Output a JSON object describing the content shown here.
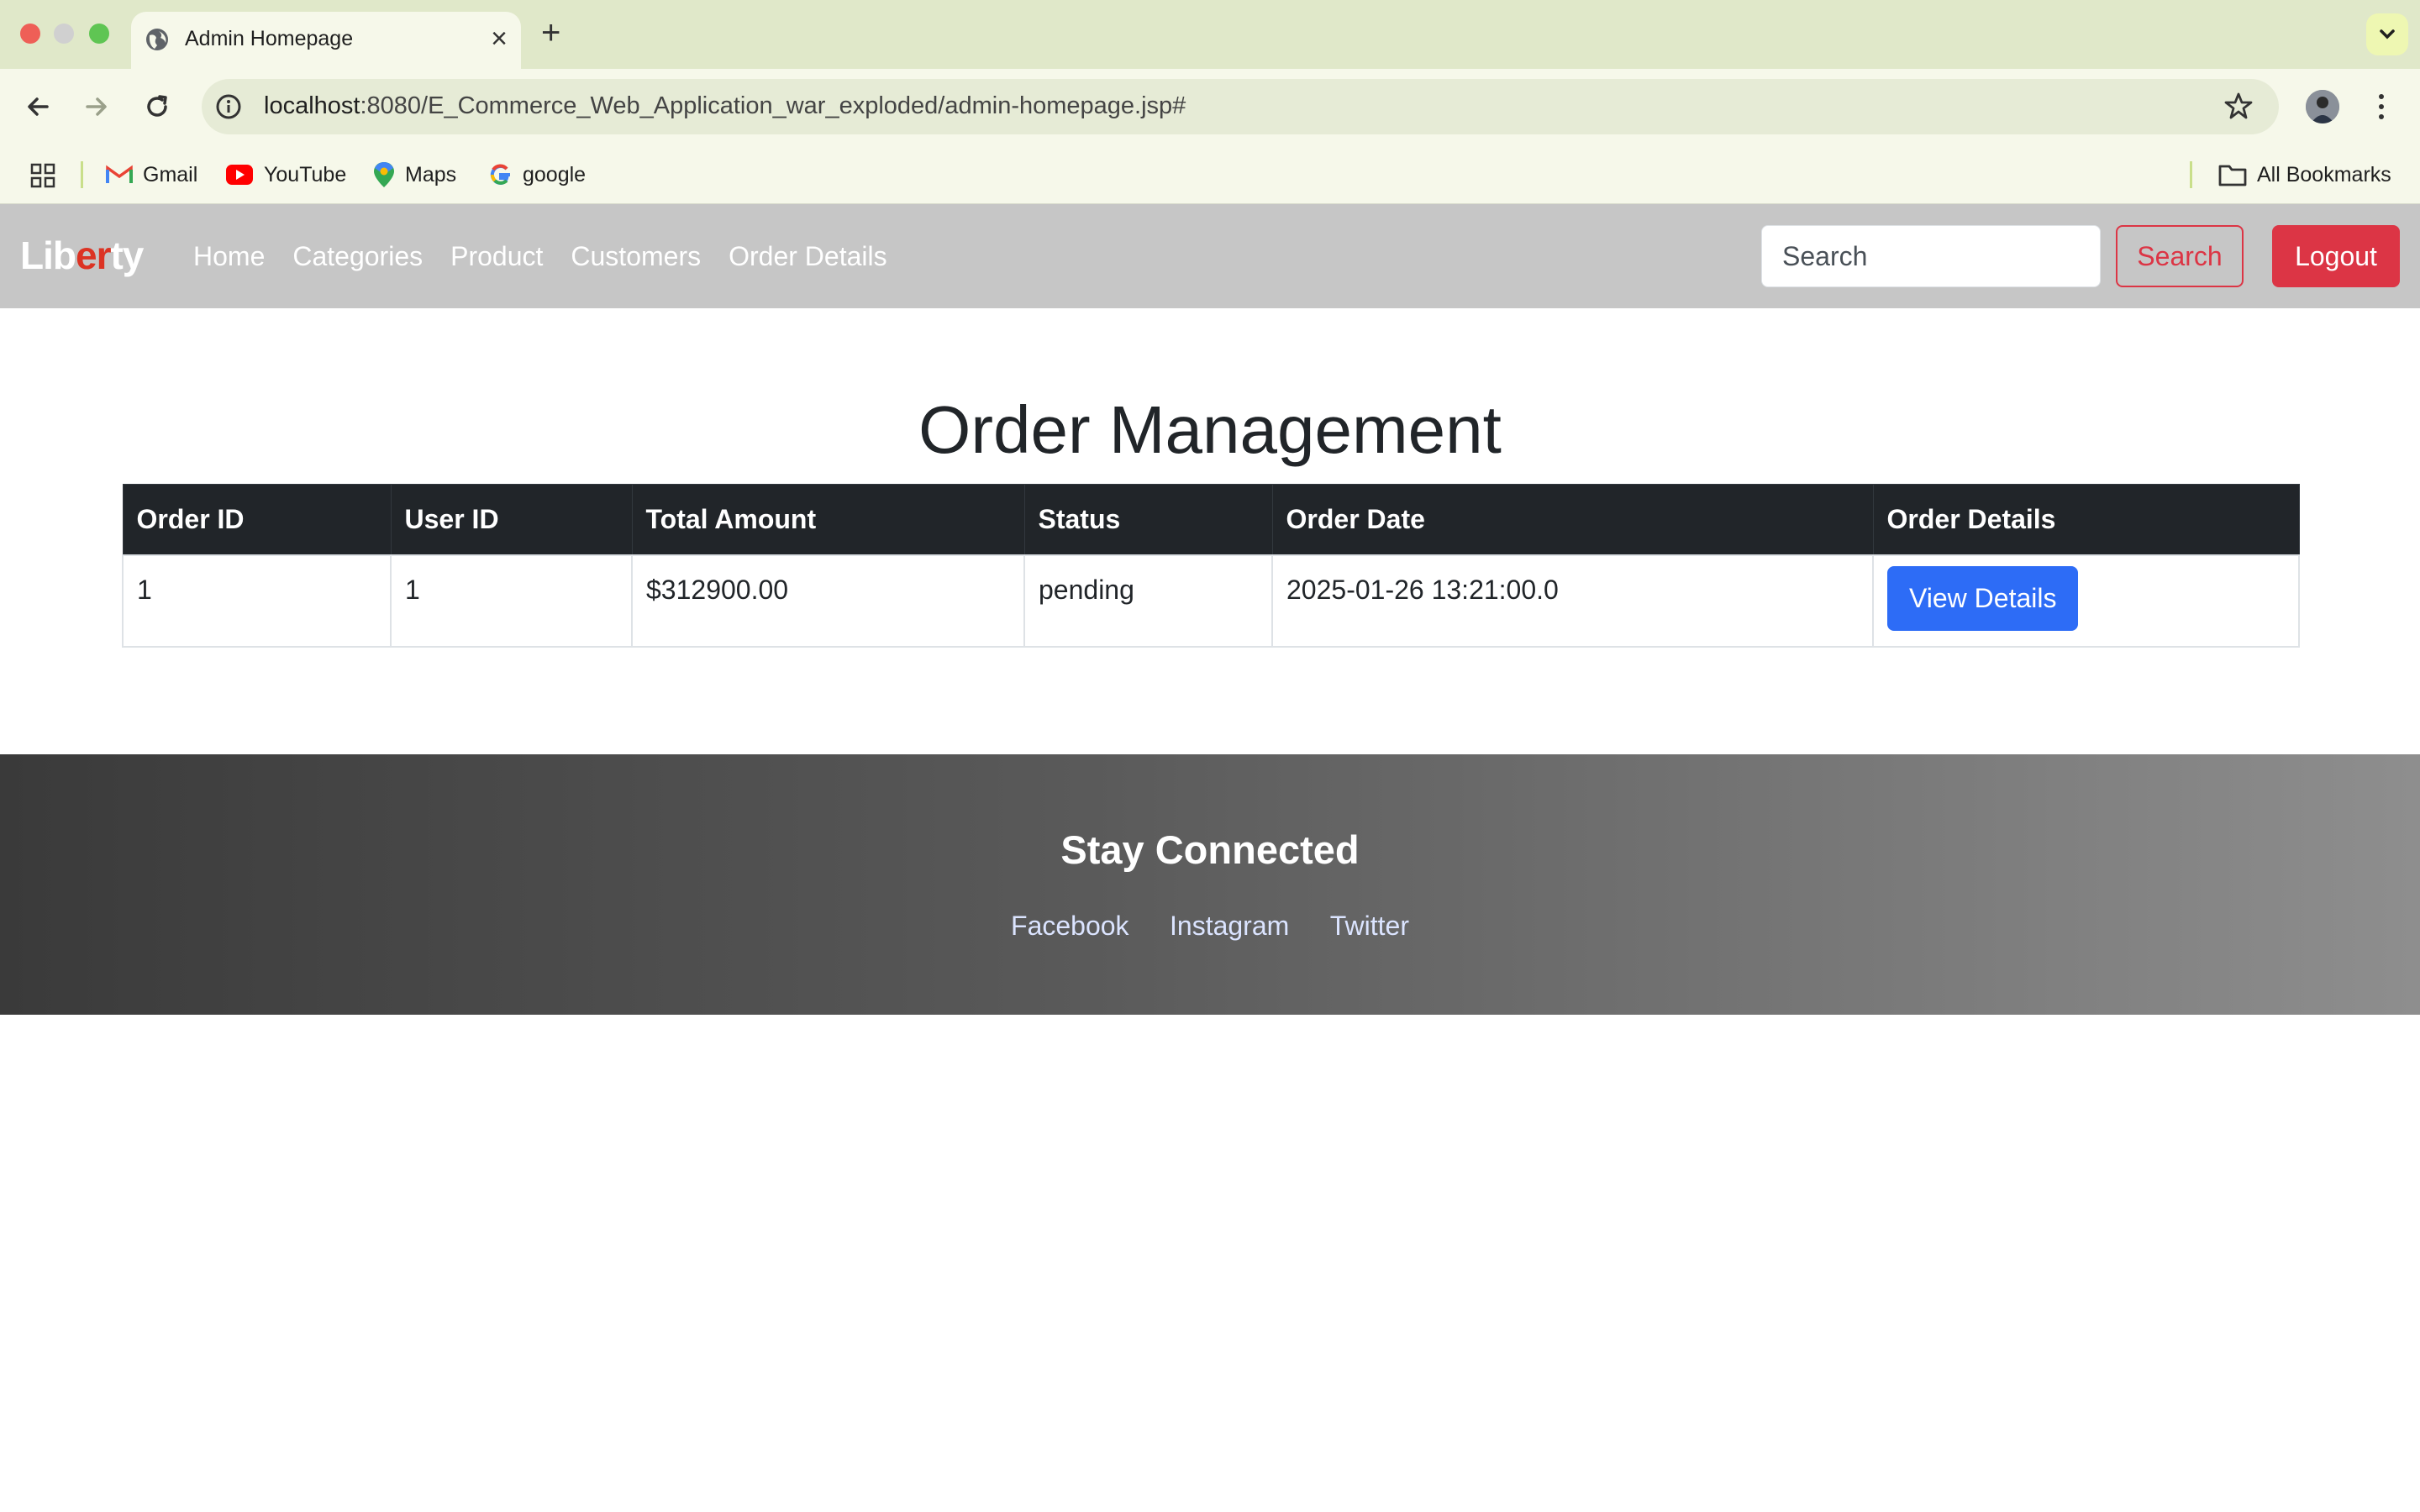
{
  "browser": {
    "tab_title": "Admin Homepage",
    "url_host": "localhost",
    "url_rest": ":8080/E_Commerce_Web_Application_war_exploded/admin-homepage.jsp#",
    "bookmarks": [
      {
        "label": "Gmail",
        "icon": "gmail-icon"
      },
      {
        "label": "YouTube",
        "icon": "youtube-icon"
      },
      {
        "label": "Maps",
        "icon": "maps-icon"
      },
      {
        "label": "google",
        "icon": "google-icon"
      }
    ],
    "all_bookmarks_label": "All Bookmarks"
  },
  "navbar": {
    "brand_parts": [
      "Lib",
      "er",
      "ty"
    ],
    "links": [
      "Home",
      "Categories",
      "Product",
      "Customers",
      "Order Details"
    ],
    "search_placeholder": "Search",
    "search_button": "Search",
    "logout_button": "Logout"
  },
  "main": {
    "title": "Order Management",
    "columns": [
      "Order ID",
      "User ID",
      "Total Amount",
      "Status",
      "Order Date",
      "Order Details"
    ],
    "rows": [
      {
        "order_id": "1",
        "user_id": "1",
        "total_amount": "$312900.00",
        "status": "pending",
        "order_date": "2025-01-26 13:21:00.0",
        "action": "View Details"
      }
    ]
  },
  "footer": {
    "heading": "Stay Connected",
    "links": [
      "Facebook",
      "Instagram",
      "Twitter"
    ]
  },
  "colors": {
    "navbar_bg": "#c6c6c6",
    "brand_accent": "#dc3323",
    "danger": "#dc3545",
    "primary": "#2d6cf6",
    "table_header": "#212529"
  }
}
